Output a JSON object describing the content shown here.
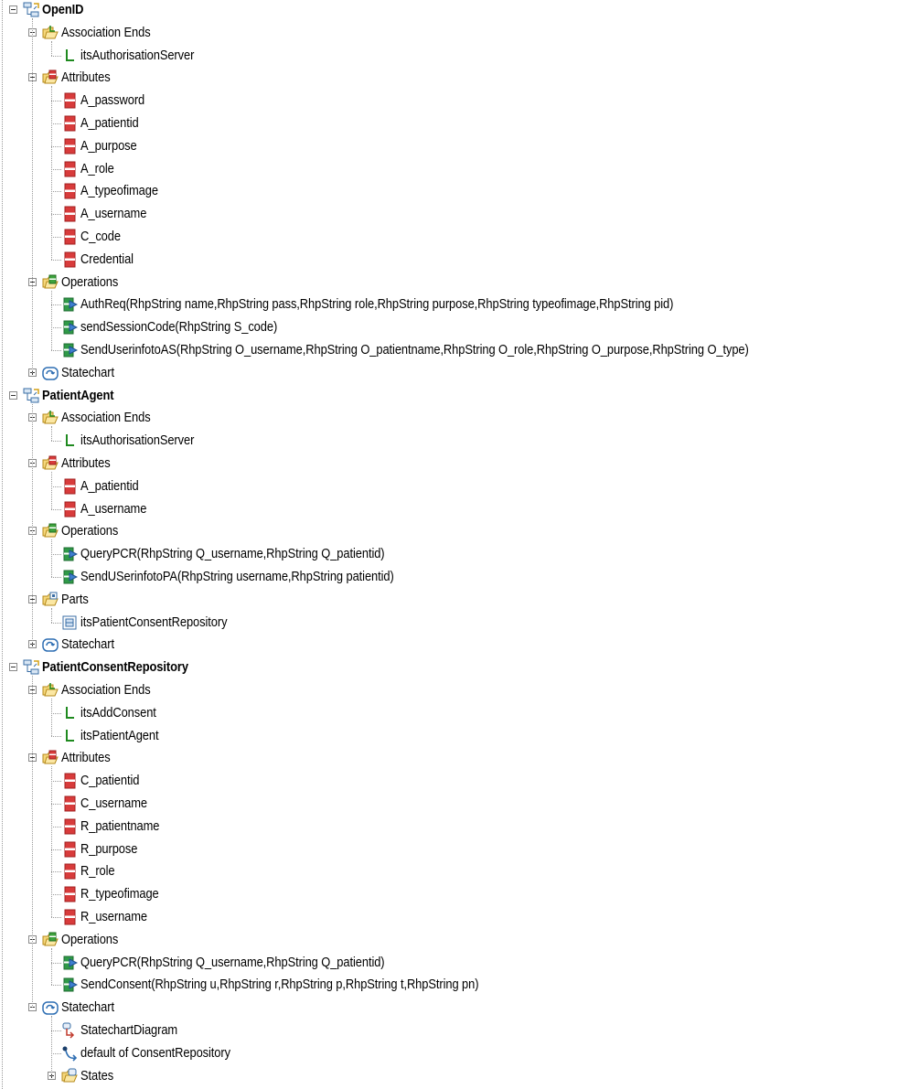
{
  "tree": [
    {
      "label": "OpenID",
      "bold": true,
      "icon": "class-icon",
      "toggle": "minus",
      "children": [
        {
          "label": "Association Ends",
          "icon": "association-folder-icon",
          "toggle": "minus",
          "children": [
            {
              "label": "itsAuthorisationServer",
              "icon": "association-end-icon"
            }
          ]
        },
        {
          "label": "Attributes",
          "icon": "attribute-folder-icon",
          "toggle": "minus",
          "children": [
            {
              "label": "A_password",
              "icon": "attribute-icon"
            },
            {
              "label": "A_patientid",
              "icon": "attribute-icon"
            },
            {
              "label": "A_purpose",
              "icon": "attribute-icon"
            },
            {
              "label": "A_role",
              "icon": "attribute-icon"
            },
            {
              "label": "A_typeofimage",
              "icon": "attribute-icon"
            },
            {
              "label": "A_username",
              "icon": "attribute-icon"
            },
            {
              "label": "C_code",
              "icon": "attribute-icon"
            },
            {
              "label": "Credential",
              "icon": "attribute-icon"
            }
          ]
        },
        {
          "label": "Operations",
          "icon": "operation-folder-icon",
          "toggle": "minus",
          "children": [
            {
              "label": "AuthReq(RhpString name,RhpString pass,RhpString role,RhpString purpose,RhpString typeofimage,RhpString pid)",
              "icon": "operation-icon"
            },
            {
              "label": "sendSessionCode(RhpString S_code)",
              "icon": "operation-icon"
            },
            {
              "label": "SendUserinfotoAS(RhpString O_username,RhpString O_patientname,RhpString O_role,RhpString O_purpose,RhpString O_type)",
              "icon": "operation-icon"
            }
          ]
        },
        {
          "label": "Statechart",
          "icon": "statechart-icon",
          "toggle": "plus",
          "children": []
        }
      ]
    },
    {
      "label": "PatientAgent",
      "bold": true,
      "icon": "class-icon",
      "toggle": "minus",
      "children": [
        {
          "label": "Association Ends",
          "icon": "association-folder-icon",
          "toggle": "minus",
          "children": [
            {
              "label": "itsAuthorisationServer",
              "icon": "association-end-icon"
            }
          ]
        },
        {
          "label": "Attributes",
          "icon": "attribute-folder-icon",
          "toggle": "minus",
          "children": [
            {
              "label": "A_patientid",
              "icon": "attribute-icon"
            },
            {
              "label": "A_username",
              "icon": "attribute-icon"
            }
          ]
        },
        {
          "label": "Operations",
          "icon": "operation-folder-icon",
          "toggle": "minus",
          "children": [
            {
              "label": "QueryPCR(RhpString Q_username,RhpString Q_patientid)",
              "icon": "operation-icon"
            },
            {
              "label": "SendUSerinfotoPA(RhpString username,RhpString patientid)",
              "icon": "operation-icon"
            }
          ]
        },
        {
          "label": "Parts",
          "icon": "parts-folder-icon",
          "toggle": "minus",
          "children": [
            {
              "label": "itsPatientConsentRepository",
              "icon": "part-icon"
            }
          ]
        },
        {
          "label": "Statechart",
          "icon": "statechart-icon",
          "toggle": "plus",
          "children": []
        }
      ]
    },
    {
      "label": "PatientConsentRepository",
      "bold": true,
      "icon": "class-icon",
      "toggle": "minus",
      "children": [
        {
          "label": "Association Ends",
          "icon": "association-folder-icon",
          "toggle": "minus",
          "children": [
            {
              "label": "itsAddConsent",
              "icon": "association-end-icon"
            },
            {
              "label": "itsPatientAgent",
              "icon": "association-end-icon"
            }
          ]
        },
        {
          "label": "Attributes",
          "icon": "attribute-folder-icon",
          "toggle": "minus",
          "children": [
            {
              "label": "C_patientid",
              "icon": "attribute-icon"
            },
            {
              "label": "C_username",
              "icon": "attribute-icon"
            },
            {
              "label": "R_patientname",
              "icon": "attribute-icon"
            },
            {
              "label": "R_purpose",
              "icon": "attribute-icon"
            },
            {
              "label": "R_role",
              "icon": "attribute-icon"
            },
            {
              "label": "R_typeofimage",
              "icon": "attribute-icon"
            },
            {
              "label": "R_username",
              "icon": "attribute-icon"
            }
          ]
        },
        {
          "label": "Operations",
          "icon": "operation-folder-icon",
          "toggle": "minus",
          "children": [
            {
              "label": "QueryPCR(RhpString Q_username,RhpString Q_patientid)",
              "icon": "operation-icon"
            },
            {
              "label": "SendConsent(RhpString u,RhpString r,RhpString p,RhpString t,RhpString pn)",
              "icon": "operation-icon"
            }
          ]
        },
        {
          "label": "Statechart",
          "icon": "statechart-icon",
          "toggle": "minus",
          "children": [
            {
              "label": "StatechartDiagram",
              "icon": "statechart-diagram-icon"
            },
            {
              "label": "default of ConsentRepository",
              "icon": "default-transition-icon"
            },
            {
              "label": "States",
              "icon": "states-folder-icon",
              "toggle": "plus",
              "children": []
            }
          ]
        }
      ]
    }
  ]
}
